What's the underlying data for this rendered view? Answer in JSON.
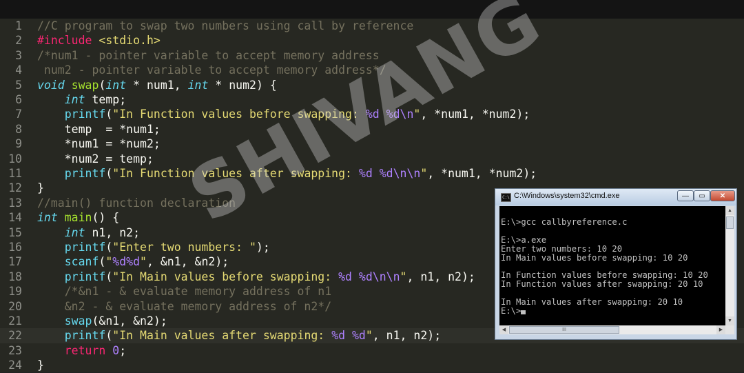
{
  "editor": {
    "lines": [
      {
        "n": "1",
        "tokens": [
          [
            "c",
            "//C program to swap two numbers using call by reference"
          ]
        ]
      },
      {
        "n": "2",
        "tokens": [
          [
            "k",
            "#include"
          ],
          [
            "p",
            " "
          ],
          [
            "s",
            "<stdio.h>"
          ]
        ]
      },
      {
        "n": "3",
        "tokens": [
          [
            "c",
            "/*num1 - pointer variable to accept memory address"
          ]
        ]
      },
      {
        "n": "4",
        "tokens": [
          [
            "c",
            " num2 - pointer variable to accept memory address*/"
          ]
        ]
      },
      {
        "n": "5",
        "tokens": [
          [
            "t",
            "void"
          ],
          [
            "p",
            " "
          ],
          [
            "f",
            "swap"
          ],
          [
            "p",
            "("
          ],
          [
            "t",
            "int"
          ],
          [
            "p",
            " * num1, "
          ],
          [
            "t",
            "int"
          ],
          [
            "p",
            " * num2) {"
          ]
        ]
      },
      {
        "n": "6",
        "tokens": [
          [
            "p",
            "    "
          ],
          [
            "t",
            "int"
          ],
          [
            "p",
            " temp;"
          ]
        ]
      },
      {
        "n": "7",
        "tokens": [
          [
            "p",
            "    "
          ],
          [
            "b",
            "printf"
          ],
          [
            "p",
            "("
          ],
          [
            "s",
            "\"In Function values before swapping: "
          ],
          [
            "n",
            "%d %d\\n"
          ],
          [
            "s",
            "\""
          ],
          [
            "p",
            ", *num1, *num2);"
          ]
        ]
      },
      {
        "n": "8",
        "tokens": [
          [
            "p",
            "    temp  = *num1;"
          ]
        ]
      },
      {
        "n": "9",
        "tokens": [
          [
            "p",
            "    *num1 = *num2;"
          ]
        ]
      },
      {
        "n": "10",
        "tokens": [
          [
            "p",
            "    *num2 = temp;"
          ]
        ]
      },
      {
        "n": "11",
        "tokens": [
          [
            "p",
            "    "
          ],
          [
            "b",
            "printf"
          ],
          [
            "p",
            "("
          ],
          [
            "s",
            "\"In Function values after swapping: "
          ],
          [
            "n",
            "%d %d\\n\\n"
          ],
          [
            "s",
            "\""
          ],
          [
            "p",
            ", *num1, *num2);"
          ]
        ]
      },
      {
        "n": "12",
        "tokens": [
          [
            "p",
            "}"
          ]
        ]
      },
      {
        "n": "13",
        "tokens": [
          [
            "c",
            "//main() function declaration"
          ]
        ]
      },
      {
        "n": "14",
        "tokens": [
          [
            "t",
            "int"
          ],
          [
            "p",
            " "
          ],
          [
            "f",
            "main"
          ],
          [
            "p",
            "() {"
          ]
        ]
      },
      {
        "n": "15",
        "tokens": [
          [
            "p",
            "    "
          ],
          [
            "t",
            "int"
          ],
          [
            "p",
            " n1, n2;"
          ]
        ]
      },
      {
        "n": "16",
        "tokens": [
          [
            "p",
            "    "
          ],
          [
            "b",
            "printf"
          ],
          [
            "p",
            "("
          ],
          [
            "s",
            "\"Enter two numbers: \""
          ],
          [
            "p",
            ");"
          ]
        ]
      },
      {
        "n": "17",
        "tokens": [
          [
            "p",
            "    "
          ],
          [
            "b",
            "scanf"
          ],
          [
            "p",
            "("
          ],
          [
            "s",
            "\""
          ],
          [
            "n",
            "%d%d"
          ],
          [
            "s",
            "\""
          ],
          [
            "p",
            ", &n1, &n2);"
          ]
        ]
      },
      {
        "n": "18",
        "tokens": [
          [
            "p",
            "    "
          ],
          [
            "b",
            "printf"
          ],
          [
            "p",
            "("
          ],
          [
            "s",
            "\"In Main values before swapping: "
          ],
          [
            "n",
            "%d %d\\n\\n"
          ],
          [
            "s",
            "\""
          ],
          [
            "p",
            ", n1, n2);"
          ]
        ]
      },
      {
        "n": "19",
        "tokens": [
          [
            "p",
            "    "
          ],
          [
            "c",
            "/*&n1 - & evaluate memory address of n1"
          ]
        ]
      },
      {
        "n": "20",
        "tokens": [
          [
            "c",
            "    &n2 - & evaluate memory address of n2*/"
          ]
        ]
      },
      {
        "n": "21",
        "tokens": [
          [
            "p",
            "    "
          ],
          [
            "b",
            "swap"
          ],
          [
            "p",
            "(&n1, &n2);"
          ]
        ]
      },
      {
        "n": "22",
        "tokens": [
          [
            "p",
            "    "
          ],
          [
            "b",
            "printf"
          ],
          [
            "p",
            "("
          ],
          [
            "s",
            "\"In Main values after swapping: "
          ],
          [
            "n",
            "%d %d"
          ],
          [
            "s",
            "\""
          ],
          [
            "p",
            ", n1, n2);"
          ]
        ]
      },
      {
        "n": "23",
        "tokens": [
          [
            "p",
            "    "
          ],
          [
            "kw",
            "return"
          ],
          [
            "p",
            " "
          ],
          [
            "n",
            "0"
          ],
          [
            "p",
            ";"
          ]
        ]
      },
      {
        "n": "24",
        "tokens": [
          [
            "p",
            "}"
          ]
        ]
      }
    ],
    "active_line": "22"
  },
  "watermark": "SHIVANG",
  "cmd_window": {
    "title": "C:\\Windows\\system32\\cmd.exe",
    "icon_label": "C:\\",
    "buttons": {
      "minimize": "—",
      "maximize": "▭",
      "close": "✕"
    },
    "lines": [
      "",
      "E:\\>gcc callbyreference.c",
      "",
      "E:\\>a.exe",
      "Enter two numbers: 10 20",
      "In Main values before swapping: 10 20",
      "",
      "In Function values before swapping: 10 20",
      "In Function values after swapping: 20 10",
      "",
      "In Main values after swapping: 20 10",
      "E:\\>"
    ],
    "scroll": {
      "up": "▲",
      "down": "▼",
      "left": "◀",
      "right": "▶",
      "grip": "III"
    }
  },
  "colors": {
    "editor_bg": "#272822",
    "comment": "#75715e",
    "keyword": "#f92672",
    "type": "#66d9ef",
    "function": "#a6e22e",
    "string": "#e6db74",
    "number": "#ae81ff",
    "console_bg": "#000000",
    "console_text": "#c0c0c0"
  }
}
